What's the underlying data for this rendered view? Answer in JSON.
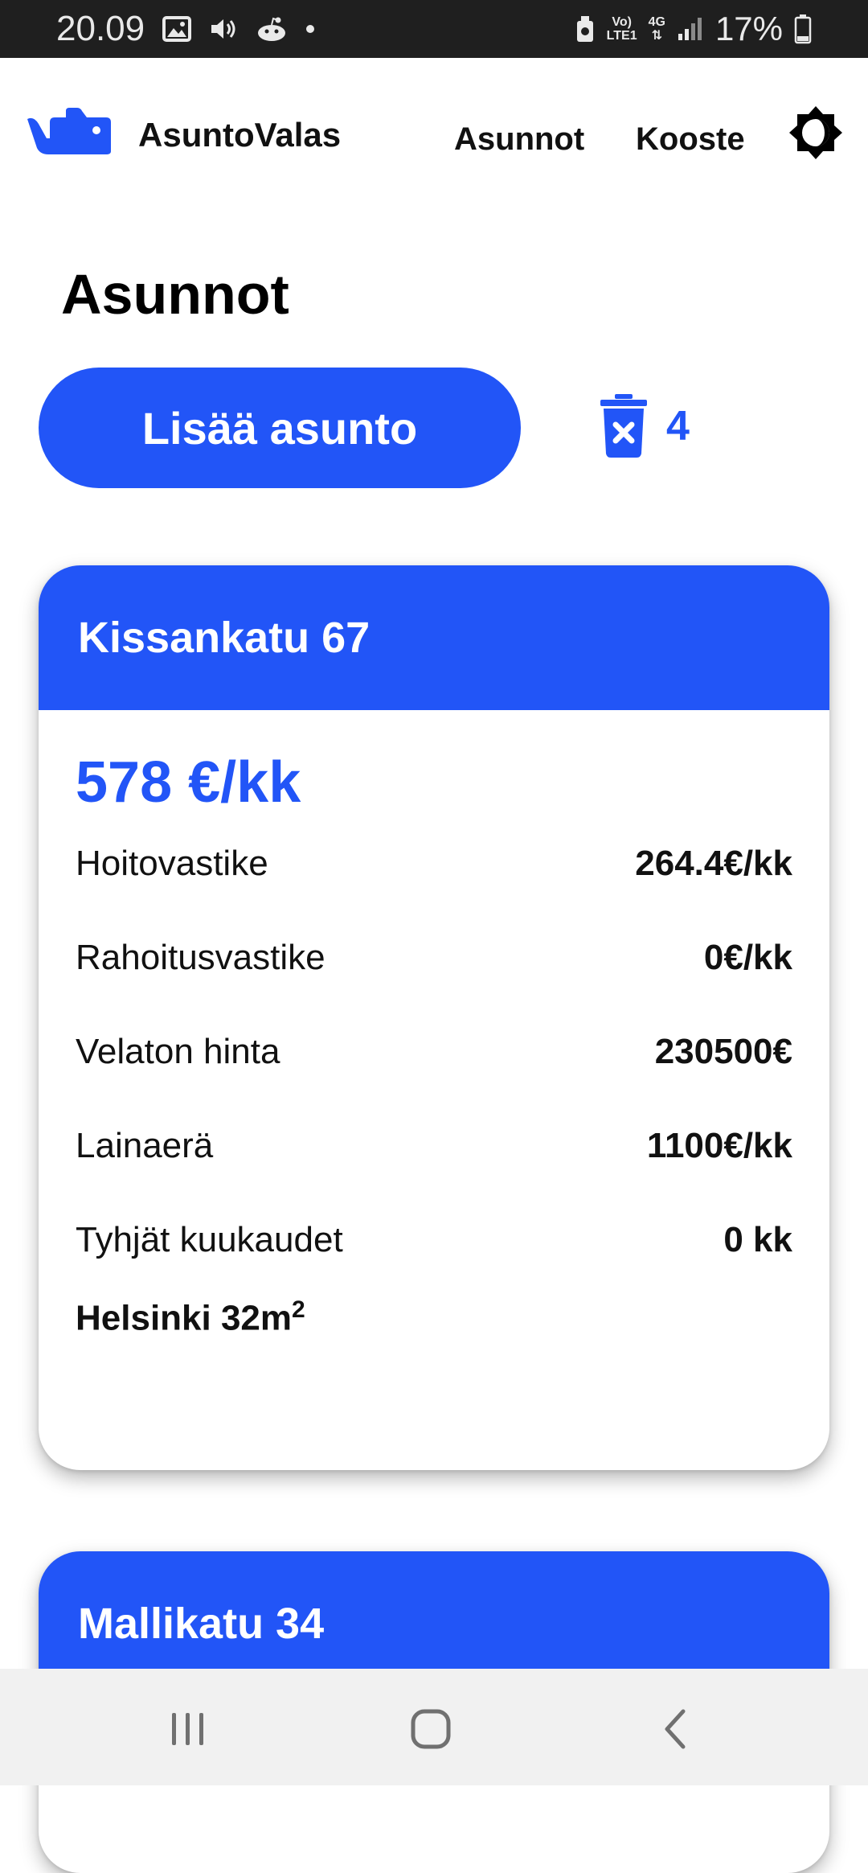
{
  "status_bar": {
    "time": "20.09",
    "network_top": "Vo)",
    "network_bottom": "LTE1",
    "network_type": "4G",
    "battery": "17%",
    "icons": [
      "image-icon",
      "volume-icon",
      "reddit-icon",
      "dot-icon",
      "alarm-icon",
      "signal-icon",
      "battery-icon"
    ]
  },
  "header": {
    "brand": "AsuntoValas",
    "logo_icon": "whale-logo-icon",
    "nav": {
      "asunnot": "Asunnot",
      "kooste": "Kooste"
    },
    "theme_icon": "theme-toggle-icon"
  },
  "page": {
    "title": "Asunnot",
    "add_button": "Lisää asunto",
    "deleted_count": "4",
    "trash_icon": "trash-icon"
  },
  "apartments": [
    {
      "title": "Kissankatu 67",
      "price": "578 €/kk",
      "rows": [
        {
          "label": "Hoitovastike",
          "value": "264.4€/kk"
        },
        {
          "label": "Rahoitusvastike",
          "value": "0€/kk"
        },
        {
          "label": "Velaton hinta",
          "value": "230500€"
        },
        {
          "label": "Lainaerä",
          "value": "1100€/kk"
        },
        {
          "label": "Tyhjät kuukaudet",
          "value": "0 kk"
        }
      ],
      "location": "Helsinki 32m",
      "location_sup": "2"
    },
    {
      "title": "Mallikatu 34"
    }
  ],
  "system_nav": {
    "icons": [
      "recents-icon",
      "home-icon",
      "back-icon"
    ]
  },
  "colors": {
    "accent": "#2255f7",
    "status_bar": "#1f1f1f",
    "nav_bar": "#f1f1f1"
  }
}
